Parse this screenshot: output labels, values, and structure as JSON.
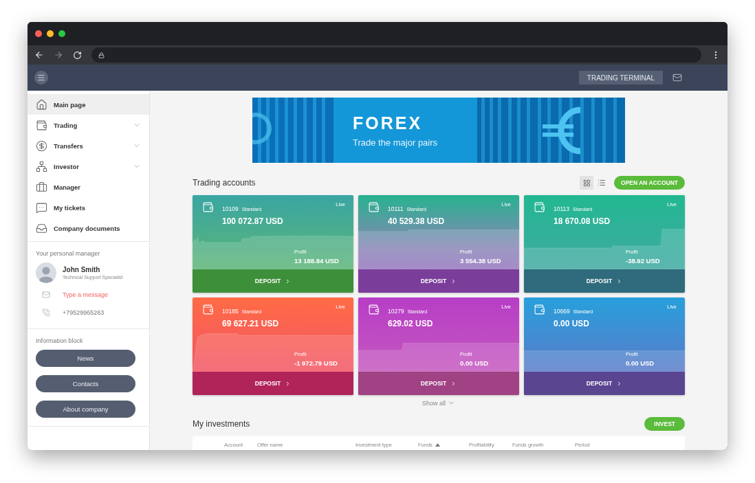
{
  "header": {
    "terminal_button": "TRADING TERMINAL"
  },
  "sidebar": {
    "nav": [
      {
        "label": "Main page",
        "selected": true,
        "expandable": false
      },
      {
        "label": "Trading",
        "selected": false,
        "expandable": true
      },
      {
        "label": "Transfers",
        "selected": false,
        "expandable": true
      },
      {
        "label": "Investor",
        "selected": false,
        "expandable": true
      },
      {
        "label": "Manager",
        "selected": false,
        "expandable": false
      },
      {
        "label": "My tickets",
        "selected": false,
        "expandable": false
      },
      {
        "label": "Company documents",
        "selected": false,
        "expandable": false
      }
    ],
    "manager": {
      "heading": "Your personal manager",
      "name": "John Smith",
      "role": "Technical Support Specialist",
      "message_link": "Type a message",
      "phone": "+79529965263"
    },
    "info": {
      "heading": "Information block",
      "buttons": [
        "News",
        "Contacts",
        "About company"
      ]
    }
  },
  "banner": {
    "title": "FOREX",
    "subtitle": "Trade the major pairs"
  },
  "accounts": {
    "title": "Trading accounts",
    "views": [
      {
        "selected": true
      },
      {
        "selected": false
      }
    ],
    "open_button": "OPEN AN ACCOUNT",
    "show_all": "Show all",
    "cards": [
      {
        "number": "10109",
        "type": "Standard",
        "status": "Live",
        "balance": "100 072.87 USD",
        "profit_label": "Profit",
        "profit": "13 188.84 USD",
        "deposit": "DEPOSIT",
        "color": "#3e8f3a"
      },
      {
        "number": "10111",
        "type": "Standard",
        "status": "Live",
        "balance": "40 529.38 USD",
        "profit_label": "Profit",
        "profit": "3 554.38 USD",
        "deposit": "DEPOSIT",
        "color": "#7b3d9a"
      },
      {
        "number": "10113",
        "type": "Standard",
        "status": "Live",
        "balance": "18 670.08 USD",
        "profit_label": "Profit",
        "profit": "-38.92 USD",
        "deposit": "DEPOSIT",
        "color": "#2f6b7c"
      },
      {
        "number": "10185",
        "type": "Standard",
        "status": "Live",
        "balance": "69 627.21 USD",
        "profit_label": "Profit",
        "profit": "-1 972.79 USD",
        "deposit": "DEPOSIT",
        "color": "#b0245a"
      },
      {
        "number": "10279",
        "type": "Standard",
        "status": "Live",
        "balance": "629.02 USD",
        "profit_label": "Profit",
        "profit": "0.00 USD",
        "deposit": "DEPOSIT",
        "color": "#a04283"
      },
      {
        "number": "10669",
        "type": "Standard",
        "status": "Live",
        "balance": "0.00 USD",
        "profit_label": "Profit",
        "profit": "0.00 USD",
        "deposit": "DEPOSIT",
        "color": "#5a4590"
      }
    ]
  },
  "investments": {
    "title": "My investments",
    "invest_button": "INVEST",
    "columns": [
      {
        "label": "Account",
        "sorted": false
      },
      {
        "label": "Offer name",
        "sorted": false
      },
      {
        "label": "Investment type",
        "sorted": false
      },
      {
        "label": "Funds",
        "sorted": true
      },
      {
        "label": "Profitability",
        "sorted": false
      },
      {
        "label": "Funds growth",
        "sorted": false
      },
      {
        "label": "Period",
        "sorted": false
      }
    ]
  }
}
